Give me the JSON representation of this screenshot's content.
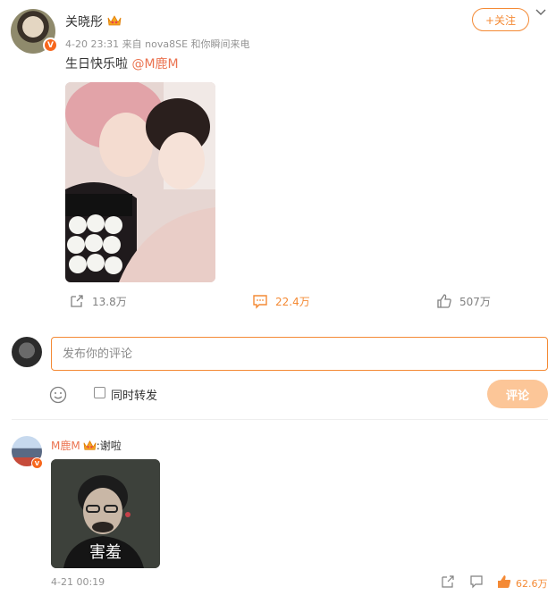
{
  "post": {
    "author": "关晓彤",
    "verified_badge": "V",
    "time": "4-20 23:31",
    "source": "来自 nova8SE 和你瞬间来电",
    "follow_label": "+关注",
    "text": "生日快乐啦",
    "mention": "@M鹿M",
    "repost_count": "13.8万",
    "comment_count": "22.4万",
    "like_count": "507万"
  },
  "composer": {
    "placeholder": "发布你的评论",
    "repost_label": "同时转发",
    "submit_label": "评论"
  },
  "comment": {
    "user": "M鹿M",
    "verified_badge": "V",
    "separator": ":",
    "text": "谢啦",
    "meme_caption": "害羞",
    "time": "4-21 00:19",
    "like_count": "62.6万"
  },
  "colors": {
    "accent": "#f48a35",
    "link": "#eb7350",
    "muted": "#939393",
    "submit_bg": "#fcc698"
  }
}
